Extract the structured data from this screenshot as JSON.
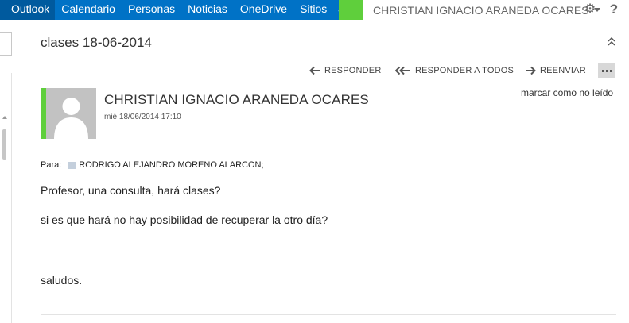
{
  "nav": {
    "items": [
      {
        "label": "Outlook",
        "active": true
      },
      {
        "label": "Calendario"
      },
      {
        "label": "Personas"
      },
      {
        "label": "Noticias"
      },
      {
        "label": "OneDrive"
      },
      {
        "label": "Sitios"
      }
    ],
    "more_label": "•••",
    "user_name": "CHRISTIAN IGNACIO ARANEDA OCARES",
    "settings_icon": "gear-icon",
    "help_label": "?",
    "colors": {
      "nav_bg": "#0072c6",
      "active_bg": "#005a9e",
      "accent_green": "#5fcf3c"
    }
  },
  "message": {
    "subject": "clases 18-06-2014",
    "actions": {
      "reply": "RESPONDER",
      "reply_all": "RESPONDER A TODOS",
      "forward": "REENVIAR"
    },
    "mark_unread": "marcar como no leído",
    "sender": {
      "name": "CHRISTIAN IGNACIO ARANEDA OCARES",
      "date": "mié 18/06/2014 17:10"
    },
    "to": {
      "label": "Para:",
      "recipient": "RODRIGO ALEJANDRO MORENO ALARCON;"
    },
    "body": [
      "Profesor, una consulta, hará clases?",
      "si es que hará no hay posibilidad de recuperar la otro día?",
      "saludos."
    ]
  }
}
